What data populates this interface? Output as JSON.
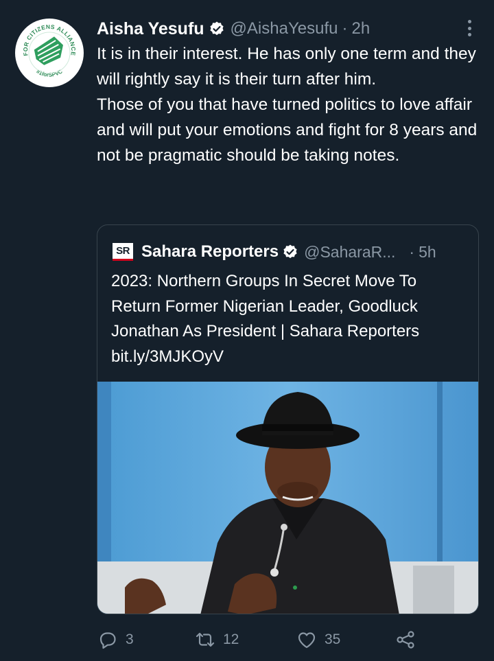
{
  "tweet": {
    "author": {
      "name": "Aisha Yesufu",
      "handle": "@AishaYesufu",
      "time": "2h",
      "avatar_text_top": "FOR CITIZENS ALLIANCE",
      "avatar_text_bottom": "#1forSPVC",
      "verified": true
    },
    "text_paragraphs": [
      "It is in their interest. He has only one term and they will rightly say it is their turn after him.",
      "Those of you that have turned politics to love affair and will put your emotions and fight for 8 years and not be pragmatic should be taking notes."
    ],
    "separator": "·"
  },
  "quoted": {
    "logo_text": "SR",
    "name": "Sahara Reporters",
    "handle": "@SaharaR...",
    "time": "5h",
    "separator": "·",
    "verified": true,
    "text_lines": [
      "2023: Northern Groups In Secret Move To",
      "Return Former Nigerian Leader, Goodluck",
      "Jonathan As President | Sahara Reporters",
      "bit.ly/3MJKOyV"
    ]
  },
  "actions": {
    "reply": {
      "icon": "reply-icon",
      "count": "3"
    },
    "retweet": {
      "icon": "retweet-icon",
      "count": "12"
    },
    "like": {
      "icon": "heart-icon",
      "count": "35"
    },
    "share": {
      "icon": "share-icon"
    }
  },
  "colors": {
    "background": "#15202b",
    "text": "#ffffff",
    "muted": "#8b98a5",
    "border": "#38444d",
    "verified": "#ffffff"
  }
}
